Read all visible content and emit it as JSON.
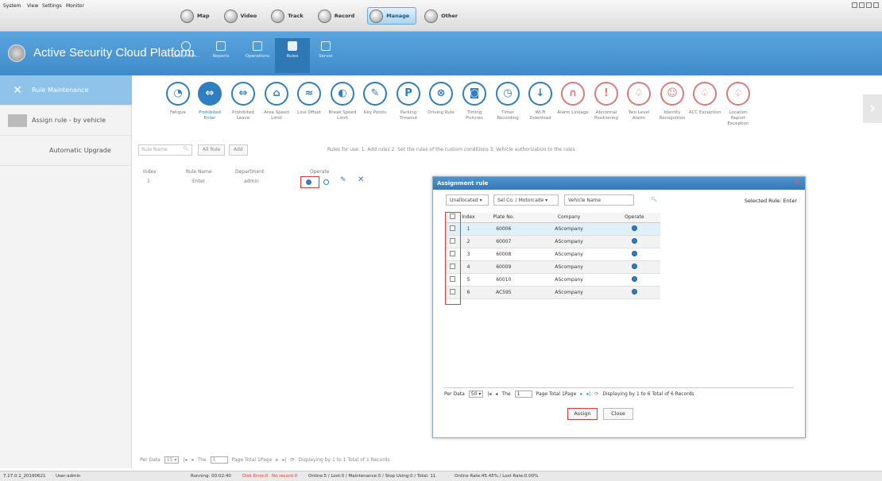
{
  "menu": {
    "items": [
      "System",
      "View",
      "Settings",
      "Monitor"
    ]
  },
  "modules": [
    {
      "label": "Map",
      "icon": "map-icon"
    },
    {
      "label": "Video",
      "icon": "video-icon"
    },
    {
      "label": "Track",
      "icon": "track-icon"
    },
    {
      "label": "Record",
      "icon": "record-icon"
    },
    {
      "label": "Manage",
      "icon": "manage-icon",
      "active": true
    },
    {
      "label": "Other",
      "icon": "other-icon"
    }
  ],
  "header": {
    "title": "Active Security Cloud Platform",
    "tabs": [
      {
        "label": "Safety Man...",
        "icon": "shield-icon"
      },
      {
        "label": "Reports",
        "icon": "chart-icon"
      },
      {
        "label": "Operations",
        "icon": "operations-icon"
      },
      {
        "label": "Rules",
        "icon": "rules-icon",
        "active": true
      },
      {
        "label": "Server",
        "icon": "server-icon"
      }
    ]
  },
  "sidebar": {
    "items": [
      {
        "label": "Rule Maintenance",
        "icon": "wrench-icon",
        "active": true
      },
      {
        "label": "Assign rule - by vehicle",
        "icon": "vehicle-icon"
      },
      {
        "label": "Automatic Upgrade",
        "icon": ""
      }
    ]
  },
  "rules": [
    {
      "label": "Fatigue"
    },
    {
      "label": "Prohibited Enter",
      "active": true
    },
    {
      "label": "Prohibited Leave"
    },
    {
      "label": "Area Speed Limit"
    },
    {
      "label": "Line Offset"
    },
    {
      "label": "Break Speed Limit"
    },
    {
      "label": "Key Points"
    },
    {
      "label": "Parking Timeout"
    },
    {
      "label": "Driving Rule"
    },
    {
      "label": "Timing Pictures"
    },
    {
      "label": "Timer Recording"
    },
    {
      "label": "Wi-Fi Download"
    },
    {
      "label": "Alarm Linkage"
    },
    {
      "label": "Abnormal Positioning"
    },
    {
      "label": "Two Level Alarm"
    },
    {
      "label": "Identity Recognition"
    },
    {
      "label": "ACC Exception"
    },
    {
      "label": "Location Report Exception"
    }
  ],
  "toolbar": {
    "rule_name_placeholder": "Rule Name",
    "all_rule": "All Rule",
    "add": "Add",
    "hint": "Rules for use: 1. Add rules 2. Set the rules of the custom conditions 3. Vehicle authorization to the rules"
  },
  "grid": {
    "headers": {
      "index": "Index",
      "name": "Rule Name",
      "dept": "Department",
      "operate": "Operate"
    },
    "row": {
      "index": "1",
      "name": "Enter",
      "dept": "admin"
    }
  },
  "bottomnav": {
    "per_data": "Per Data",
    "per_value": "15",
    "the": "The",
    "page": "1",
    "page_total": "Page Total 1Page",
    "info": "Displaying by 1 to 1 Total of 1 Records"
  },
  "dialog": {
    "title": "Assignment rule",
    "unallocated": "Unallocated",
    "company_select": "Sel Co. / Motorcade",
    "vehicle_placeholder": "Vehicle Name",
    "selected_rule": "Selected Rule: Enter",
    "headers": {
      "index": "Index",
      "plate": "Plate No.",
      "company": "Company",
      "operate": "Operate"
    },
    "rows": [
      {
        "index": "1",
        "plate": "60006",
        "company": "AScompany"
      },
      {
        "index": "2",
        "plate": "60007",
        "company": "AScompany"
      },
      {
        "index": "3",
        "plate": "60008",
        "company": "AScompany"
      },
      {
        "index": "4",
        "plate": "60009",
        "company": "AScompany"
      },
      {
        "index": "5",
        "plate": "60010",
        "company": "AScompany"
      },
      {
        "index": "6",
        "plate": "AC595",
        "company": "AScompany"
      }
    ],
    "footer": {
      "per_data": "Per Data",
      "per_value": "50",
      "the": "The",
      "page": "1",
      "page_total": "Page Total 1Page",
      "info": "Displaying by 1 to 6 Total of 6 Records"
    },
    "assign": "Assign",
    "close": "Close"
  },
  "status": {
    "version": "7.17.0.1_20190621",
    "user": "User:admin",
    "running": "Running: 00:02:40",
    "disk_error": "Disk Error:0",
    "no_record": "No record:0",
    "online": "Online:5 / Lost:0 / Maintenance:0 / Stop Using:0 / Total: 11",
    "rate": "Online Rate:45.45% / Lost Rate:0.00%"
  },
  "colors": {
    "accent": "#2d7fc1",
    "header": "#4a97d4",
    "highlight": "#e03a3a"
  }
}
